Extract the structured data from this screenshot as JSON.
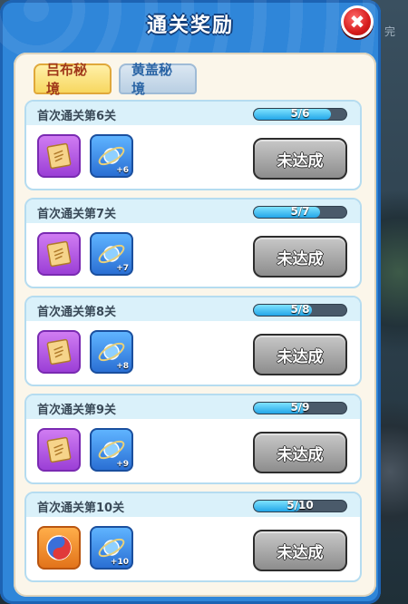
{
  "background_text": "完",
  "dialog": {
    "title": "通关奖励",
    "close_glyph": "✖"
  },
  "tabs": [
    {
      "label": "吕布秘境",
      "active": true
    },
    {
      "label": "黄盖秘境",
      "active": false
    }
  ],
  "rows": [
    {
      "title": "首次通关第6关",
      "progress_text": "5/6",
      "progress": 0.833,
      "item1": "scroll-icon",
      "item2_count": "+6",
      "button": "未达成"
    },
    {
      "title": "首次通关第7关",
      "progress_text": "5/7",
      "progress": 0.714,
      "item1": "scroll-icon",
      "item2_count": "+7",
      "button": "未达成"
    },
    {
      "title": "首次通关第8关",
      "progress_text": "5/8",
      "progress": 0.625,
      "item1": "scroll-icon",
      "item2_count": "+8",
      "button": "未达成"
    },
    {
      "title": "首次通关第9关",
      "progress_text": "5/9",
      "progress": 0.556,
      "item1": "scroll-icon",
      "item2_count": "+9",
      "button": "未达成"
    },
    {
      "title": "首次通关第10关",
      "progress_text": "5/10",
      "progress": 0.5,
      "item1": "orb-icon",
      "item2_count": "+10",
      "button": "未达成"
    }
  ]
}
